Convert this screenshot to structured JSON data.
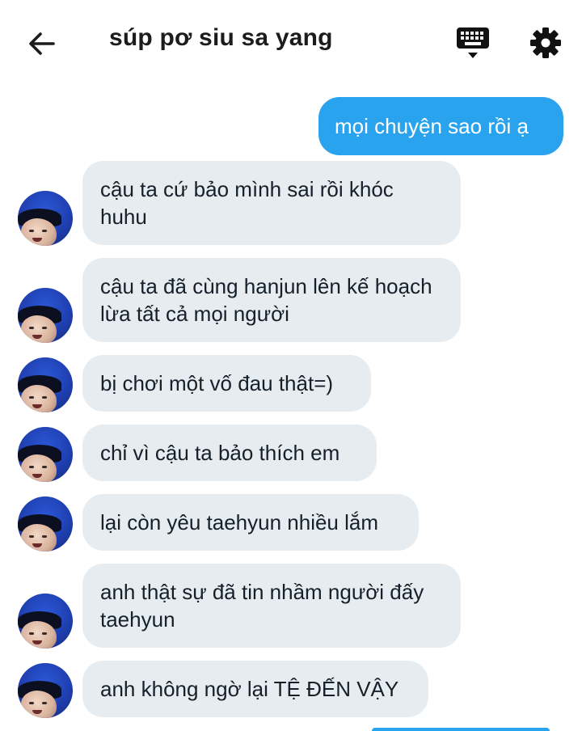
{
  "header": {
    "title": "súp pơ siu sa yang",
    "back_icon": "arrow-left-icon",
    "keyboard_icon": "keyboard-icon",
    "settings_icon": "gear-icon"
  },
  "colors": {
    "outgoing_bubble": "#2aa3ef",
    "incoming_bubble": "#e6ecf0",
    "text_dark": "#15202b"
  },
  "messages": [
    {
      "direction": "outgoing",
      "text": "mọi chuyện sao rồi ạ"
    },
    {
      "direction": "incoming",
      "text": "cậu ta cứ bảo mình sai rồi khóc huhu"
    },
    {
      "direction": "incoming",
      "text": "cậu ta đã cùng hanjun lên kế hoạch lừa tất cả mọi người"
    },
    {
      "direction": "incoming",
      "text": "bị chơi một vố đau thật=)"
    },
    {
      "direction": "incoming",
      "text": "chỉ vì cậu ta bảo thích em"
    },
    {
      "direction": "incoming",
      "text": "lại còn yêu taehyun nhiều lắm"
    },
    {
      "direction": "incoming",
      "text": "anh thật sự đã tin nhầm người đấy taehyun"
    },
    {
      "direction": "incoming",
      "text": "anh không ngờ lại TỆ ĐẾN VẬY"
    }
  ]
}
